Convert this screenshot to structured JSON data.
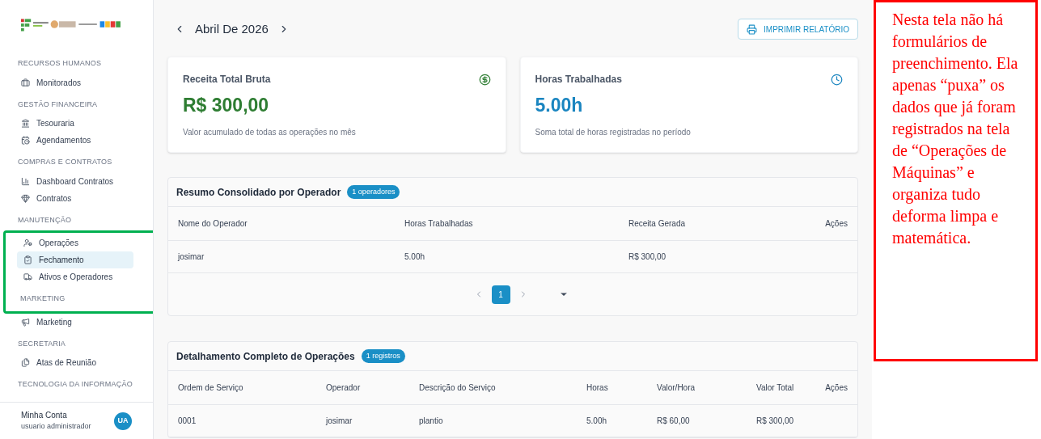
{
  "sidebar": {
    "entries": [
      {
        "kind": "heading",
        "label": "RECURSOS HUMANOS",
        "highlighted": false
      },
      {
        "kind": "item",
        "label": "Monitorados",
        "selected": false,
        "highlighted": false
      },
      {
        "kind": "heading",
        "label": "GESTÃO FINANCEIRA",
        "highlighted": false
      },
      {
        "kind": "item",
        "label": "Tesouraria",
        "selected": false,
        "highlighted": false
      },
      {
        "kind": "item",
        "label": "Agendamentos",
        "selected": false,
        "highlighted": false
      },
      {
        "kind": "heading",
        "label": "COMPRAS E CONTRATOS",
        "highlighted": false
      },
      {
        "kind": "item",
        "label": "Dashboard Contratos",
        "selected": false,
        "highlighted": false
      },
      {
        "kind": "item",
        "label": "Contratos",
        "selected": false,
        "highlighted": false
      },
      {
        "kind": "heading",
        "label": "MANUTENÇÃO",
        "highlighted": false
      },
      {
        "kind": "item",
        "label": "Operações",
        "selected": false,
        "highlighted": true
      },
      {
        "kind": "item",
        "label": "Fechamento",
        "selected": true,
        "highlighted": true
      },
      {
        "kind": "item",
        "label": "Ativos e Operadores",
        "selected": false,
        "highlighted": true
      },
      {
        "kind": "heading",
        "label": "MARKETING",
        "highlighted": true
      },
      {
        "kind": "item",
        "label": "Marketing",
        "selected": false,
        "highlighted": false
      },
      {
        "kind": "heading",
        "label": "SECRETARIA",
        "highlighted": false
      },
      {
        "kind": "item",
        "label": "Atas de Reunião",
        "selected": false,
        "highlighted": false
      },
      {
        "kind": "heading",
        "label": "TECNOLOGIA DA INFORMAÇÃO",
        "highlighted": false
      }
    ],
    "account": {
      "name": "Minha Conta",
      "role": "usuario administrador",
      "initials": "UA"
    }
  },
  "header": {
    "month": "Abril De 2026",
    "print_button": "IMPRIMIR RELATÓRIO"
  },
  "stats": [
    {
      "title": "Receita Total Bruta",
      "value": "R$ 300,00",
      "caption": "Valor acumulado de todas as operações no mês",
      "color": "#2e7d32"
    },
    {
      "title": "Horas Trabalhadas",
      "value": "5.00h",
      "caption": "Soma total de horas registradas no período",
      "color": "#1a85c0"
    }
  ],
  "summary": {
    "title": "Resumo Consolidado por Operador",
    "badge": "1 operadores",
    "columns": [
      "Nome do Operador",
      "Horas Trabalhadas",
      "Receita Gerada",
      "Ações"
    ],
    "rows": [
      [
        "josimar",
        "5.00h",
        "R$ 300,00"
      ]
    ],
    "pages": [
      {
        "label": "1",
        "selected": true
      }
    ]
  },
  "details": {
    "title": "Detalhamento Completo de Operações",
    "badge": "1 registros",
    "columns": [
      "Ordem de Serviço",
      "Operador",
      "Descrição do Serviço",
      "Horas",
      "Valor/Hora",
      "Valor Total",
      "Ações"
    ],
    "rows": [
      [
        "0001",
        "josimar",
        "plantio",
        "5.00h",
        "R$ 60,00",
        "R$ 300,00"
      ]
    ]
  },
  "note": "Nesta tela não há formulários de preenchimento. Ela apenas “puxa” os dados que já foram registrados na tela de “Operações de Máquinas” e organiza tudo deforma limpa e matemática."
}
